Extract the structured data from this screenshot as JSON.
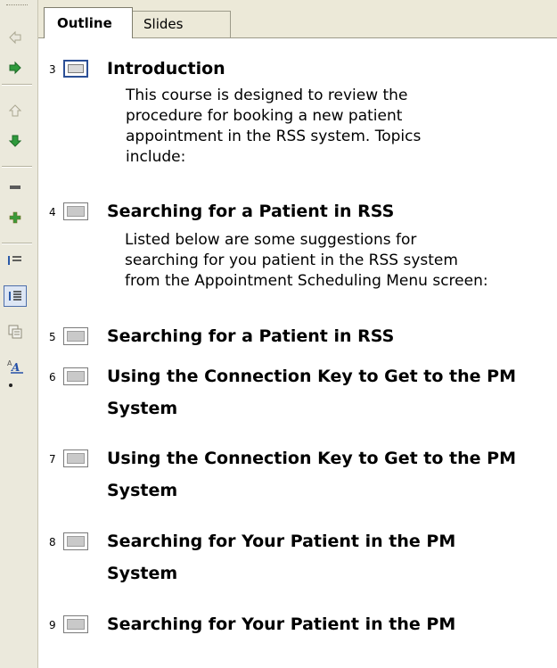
{
  "tabs": [
    {
      "label": "Outline",
      "active": true
    },
    {
      "label": "Slides",
      "active": false
    }
  ],
  "toolbar": {
    "buttons": [
      "promote-icon",
      "demote-icon",
      "move-up-icon",
      "move-down-icon",
      "collapse-icon",
      "expand-icon",
      "collapse-all-icon",
      "expand-all-icon",
      "summary-slide-icon",
      "show-formatting-icon"
    ]
  },
  "slides": [
    {
      "num": "3",
      "title": "Introduction",
      "body": [
        "This course is designed to review the",
        "procedure for booking a new patient",
        "appointment in the RSS system.  Topics",
        "include:"
      ]
    },
    {
      "num": "4",
      "title": "Searching for a Patient in RSS",
      "body": [
        "Listed below are some suggestions for",
        "searching for you patient in the RSS system",
        "from the Appointment Scheduling Menu screen:"
      ]
    },
    {
      "num": "5",
      "title": "Searching for a Patient in RSS",
      "title2": ""
    },
    {
      "num": "6",
      "title": "Using the Connection Key to Get to the PM",
      "title2": "System"
    },
    {
      "num": "7",
      "title": "Using the Connection Key to Get to the PM",
      "title2": "System"
    },
    {
      "num": "8",
      "title": "Searching for Your Patient in the PM",
      "title2": "System"
    },
    {
      "num": "9",
      "title": "Searching for Your Patient in the PM",
      "title2": ""
    }
  ]
}
